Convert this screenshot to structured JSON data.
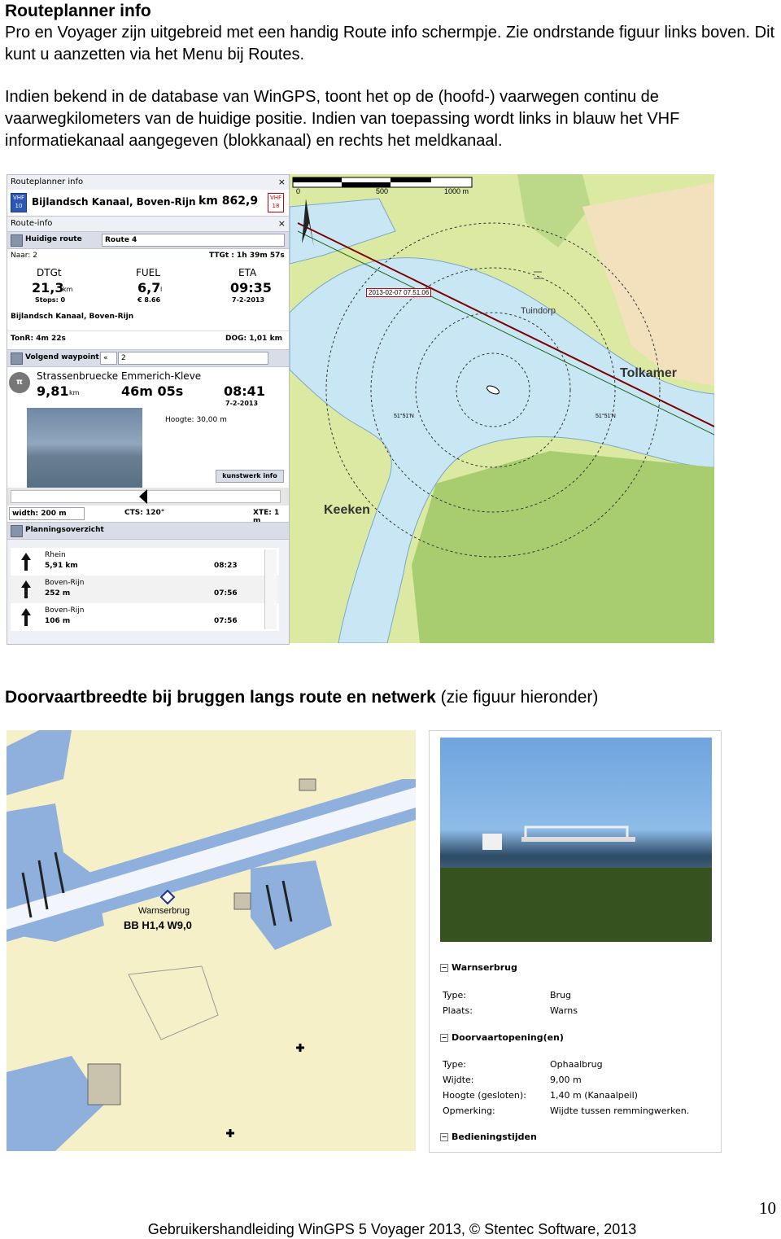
{
  "heading": "Routeplanner info",
  "intro": "Pro en Voyager zijn uitgebreid met een handig Route info schermpje. Zie ondrstande figuur links boven. Dit kunt u aanzetten via het Menu bij Routes.",
  "intro2": "Indien bekend in de database van WinGPS, toont het op de (hoofd-) vaarwegen continu de vaarwegkilometers van de huidige positie. Indien van toepassing wordt links in blauw het VHF informatiekanaal aangegeven (blokkanaal) en rechts het meldkanaal.",
  "route_panel": {
    "title": "Routeplanner info",
    "close": "×",
    "vhf_left": "VHF 10",
    "waterway": "Bijlandsch Kanaal, Boven-Rijn",
    "km": "km 862,9",
    "vhf_right": "VHF 18",
    "section": "Route-info",
    "route_label": "Huidige route",
    "route_value": "Route 4",
    "naar": "Naar: 2",
    "ttgt": "TTGt : 1h 39m 57s",
    "dtgt_label": "DTGt",
    "dtgt_value": "21,3",
    "dtgt_unit": "km",
    "stops": "Stops: 0",
    "fuel_label": "FUEL",
    "fuel_value": "6,7",
    "fuel_unit": "l",
    "fuel_cost": "€ 8.66",
    "eta_label": "ETA",
    "eta_value": "09:35",
    "eta_date": "7-2-2013",
    "waterway2": "Bijlandsch Kanaal, Boven-Rijn",
    "tonr": "TonR: 4m 22s",
    "dog": "DOG: 1,01 km",
    "waypoint_label": "Volgend waypoint",
    "waypoint_nav": "«",
    "waypoint_value": "2",
    "wp_name": "Strassenbruecke Emmerich-Kleve",
    "wp_dist": "9,81",
    "wp_dist_unit": "km",
    "wp_time": "46m 05s",
    "wp_eta": "08:41",
    "wp_date": "7-2-2013",
    "hoogte": "Hoogte: 30,00 m",
    "kunstwerk": "kunstwerk info",
    "width": "width: 200 m",
    "cts": "CTS: 120°",
    "xte": "XTE: 1 m",
    "planning": "Planningsoverzicht",
    "plan_rows": [
      {
        "name": "Rhein",
        "km": "5,91 km",
        "time": "08:23"
      },
      {
        "name": "Boven-Rijn",
        "km": "252 m",
        "time": "07:56"
      },
      {
        "name": "Boven-Rijn",
        "km": "106 m",
        "time": "07:56"
      }
    ]
  },
  "map1": {
    "scale_0": "0",
    "scale_500": "500",
    "scale_1000": "1000 m",
    "timestamp": "2013-02-07 07.51.06",
    "town1": "Tuindorp",
    "town2": "Tolkamer",
    "town3": "Keeken",
    "lat1": "51°51'N",
    "lat2": "51°51'N"
  },
  "heading2_bold": "Doorvaartbreedte bij bruggen langs route en netwerk",
  "heading2_rest": " (zie figuur hieronder)",
  "map2": {
    "bridge_name": "Warnserbrug",
    "bridge_code": "BB H1,4 W9,0"
  },
  "info_panel": {
    "section1": "Warnserbrug",
    "type_label": "Type:",
    "type_value": "Brug",
    "plaats_label": "Plaats:",
    "plaats_value": "Warns",
    "section2": "Doorvaartopening(en)",
    "type2_label": "Type:",
    "type2_value": "Ophaalbrug",
    "wijdte_label": "Wijdte:",
    "wijdte_value": "9,00 m",
    "hoogte_label": "Hoogte (gesloten):",
    "hoogte_value": "1,40 m (Kanaalpeil)",
    "opmerking_label": "Opmerking:",
    "opmerking_value": "Wijdte tussen remmingwerken.",
    "section3": "Bedieningstijden",
    "toggle": "−"
  },
  "page_number": "10",
  "footer": "Gebruikershandleiding WinGPS 5 Voyager 2013, © Stentec Software, 2013"
}
